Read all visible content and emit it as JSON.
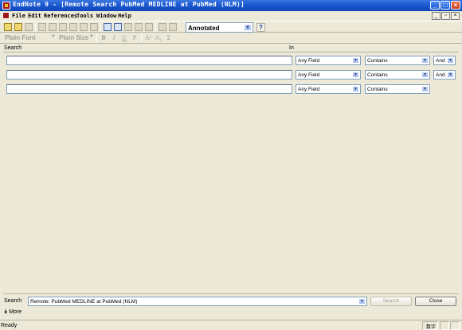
{
  "window": {
    "title": "EndNote 9 - [Remote Search PubMed MEDLINE at PubMed (NLM)]",
    "minimize": "_",
    "maximize": "□",
    "close": "×"
  },
  "menu": {
    "items": [
      "File",
      "Edit",
      "References",
      "Tools",
      "Window",
      "Help"
    ],
    "restore": "▫",
    "mdi_min": "_",
    "mdi_close": "×"
  },
  "toolbar": {
    "style": "Annotated",
    "help": "?"
  },
  "format_bar": {
    "font": "Plain Font",
    "size": "Plain Size",
    "bold": "B",
    "italic": "I",
    "underline": "U",
    "plain": "P",
    "superscript": "A¹",
    "subscript": "A₁",
    "symbol": "Σ"
  },
  "search_header": {
    "search": "Search",
    "in": "In"
  },
  "rows": [
    {
      "term": "",
      "field": "Any Field",
      "operator": "Contains",
      "bool": "And"
    },
    {
      "term": "",
      "field": "Any Field",
      "operator": "Contains",
      "bool": "And"
    },
    {
      "term": "",
      "field": "Any Field",
      "operator": "Contains"
    }
  ],
  "bottom": {
    "label": "Search",
    "connection": "Remote: PubMed MEDLINE at PubMed (NLM)",
    "search_button": "Search",
    "close_button": "Close",
    "more": "More"
  },
  "status": {
    "text": "Ready",
    "indicator": "数字"
  },
  "icons": [
    "app-icon",
    "new-icon",
    "open-icon",
    "print-icon",
    "cut-icon",
    "copy-icon",
    "paste-icon",
    "find-icon",
    "help-icon",
    "dropdown-arrow-icon",
    "chevron-down-icon"
  ]
}
